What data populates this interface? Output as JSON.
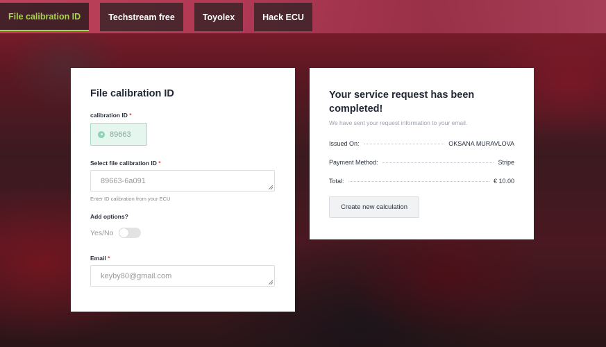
{
  "tabs": [
    {
      "label": "File calibration ID",
      "active": true
    },
    {
      "label": "Techstream free",
      "active": false
    },
    {
      "label": "Toyolex",
      "active": false
    },
    {
      "label": "Hack ECU",
      "active": false
    }
  ],
  "form": {
    "title": "File calibration ID",
    "calibration_id": {
      "label": "calibration ID",
      "value": "89663"
    },
    "select_file": {
      "label": "Select file calibration ID",
      "placeholder": "89663-6a091",
      "help": "Enter ID calibration from your ECU"
    },
    "options": {
      "label": "Add options?",
      "toggle_label": "Yes/No",
      "enabled": false
    },
    "email": {
      "label": "Email",
      "placeholder": "keyby80@gmail.com"
    },
    "required_mark": "*"
  },
  "result": {
    "title": "Your service request has been completed!",
    "subtitle": "We have sent your request information to your email.",
    "rows": [
      {
        "label": "Issued On:",
        "value": "OKSANA MURAVLOVA"
      },
      {
        "label": "Payment Method:",
        "value": "Stripe"
      },
      {
        "label": "Total:",
        "value": "€ 10.00"
      }
    ],
    "button_label": "Create new calculation"
  },
  "colors": {
    "accent": "#a6d44a",
    "required": "#e0403a",
    "success_bg": "#e5f6ee",
    "success_border": "#a8dcc7"
  }
}
